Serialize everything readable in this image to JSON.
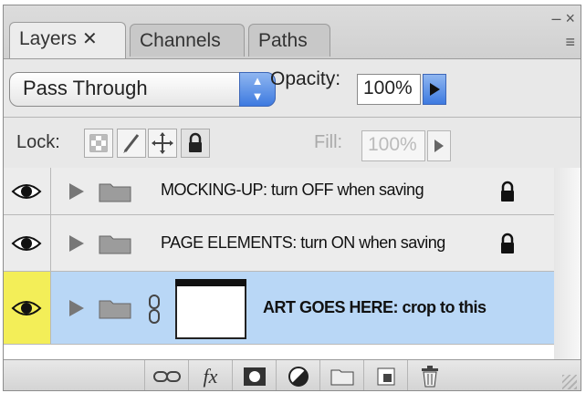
{
  "tabs": [
    {
      "label": "Layers",
      "close": "✕",
      "active": true
    },
    {
      "label": "Channels",
      "active": false
    },
    {
      "label": "Paths",
      "active": false
    }
  ],
  "panel_controls": {
    "minimize": "– ×",
    "menu": "≡"
  },
  "blend_mode": {
    "value": "Pass Through"
  },
  "opacity": {
    "label": "Opacity:",
    "value": "100%"
  },
  "lock": {
    "label": "Lock:"
  },
  "fill": {
    "label": "Fill:",
    "value": "100%"
  },
  "layers": [
    {
      "name": "MOCKING-UP: turn OFF when saving",
      "visible": true,
      "locked": true,
      "selected": false
    },
    {
      "name": "PAGE ELEMENTS: turn ON when saving",
      "visible": true,
      "locked": true,
      "selected": false
    },
    {
      "name": "ART GOES HERE: crop to this",
      "visible": true,
      "locked": false,
      "selected": true
    }
  ],
  "bottom_icons": [
    "link-layers-icon",
    "fx-icon",
    "add-mask-icon",
    "adjustment-layer-icon",
    "new-group-icon",
    "new-layer-icon",
    "trash-icon"
  ],
  "bottom_fx": "fx",
  "colors": {
    "selected_row": "#b9d7f6",
    "eye_highlight": "#f3ee58",
    "accent": "#3d7ae0"
  }
}
